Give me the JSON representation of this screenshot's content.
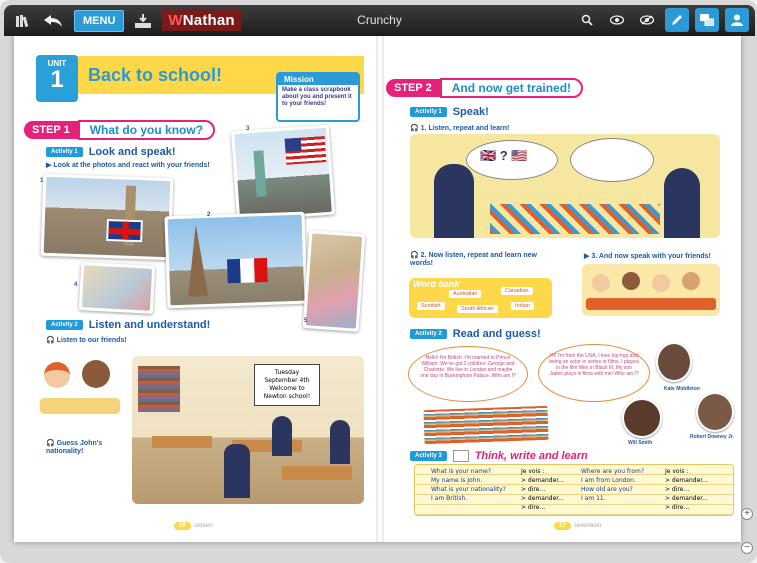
{
  "toolbar": {
    "title": "Crunchy",
    "menu_label": "MENU",
    "brand": "Nathan",
    "brand_prefix": "W",
    "left_icons": [
      "library-icon",
      "back-icon",
      "menu-button",
      "download-icon",
      "nathan-logo"
    ],
    "right_icons": [
      "search-icon",
      "eye-icon",
      "eye-slash-icon",
      "pen-icon",
      "screen-icon",
      "user-icon"
    ],
    "accent_color": "#2a9bd6"
  },
  "left_page": {
    "unit_label": "UNIT",
    "unit_number": "1",
    "unit_title": "Back to school!",
    "mission": {
      "title": "Mission",
      "text": "Make a class scrapbook about you and present it to your friends!"
    },
    "step1": {
      "label": "STEP 1",
      "title": "What do you know?"
    },
    "activity1": {
      "label": "Activity 1",
      "title": "Look and speak!",
      "instruction": "Look at the photos and react with your friends!"
    },
    "photo_numbers": [
      "1",
      "2",
      "3",
      "4",
      "5"
    ],
    "activity2": {
      "label": "Activity 2",
      "title": "Listen and understand!",
      "instruction": "Listen to our friends!"
    },
    "scene_sign": "Tuesday September 4th Welcome to Newton school!",
    "guess": "Guess John's nationality!",
    "page_number": "10",
    "page_word": "sixteen"
  },
  "right_page": {
    "step2": {
      "label": "STEP 2",
      "title": "And now get trained!"
    },
    "activity1": {
      "label": "Activity 1",
      "title": "Speak!",
      "instr1": "1. Listen, repeat and learn!",
      "instr2": "2. Now listen, repeat and learn new words!",
      "instr3": "3. And now speak with your friends!"
    },
    "word_bank": {
      "title": "Word bank",
      "words": [
        "Australian",
        "Canadian",
        "Scottish",
        "South African",
        "Indian"
      ]
    },
    "activity2": {
      "label": "Activity 2",
      "title": "Read and guess!",
      "bubble1": "Hello! I'm British. I'm married to Prince William. We've got 2 children: George and Charlotte. We live in London and maybe one day in Buckingham Palace. Who am I?",
      "bubble2": "Hi! I'm from the USA. I love hip-hop and being an actor in series or films. I played in the film Men in Black III. My son Jaden plays in films with me! Who am I?",
      "celeb1": "Kate Middleton",
      "celeb2": "Will Smith",
      "celeb3": "Robert Downey Jr."
    },
    "activity3": {
      "label": "Activity 3",
      "title": "Think, write and learn"
    },
    "table": {
      "q1": [
        "What is your name?",
        "My name is John.",
        "What is your nationality?",
        "I am British."
      ],
      "h1": "Je vois :",
      "a1": [
        "> demander...",
        "> dire...",
        "> demander...",
        "> dire..."
      ],
      "q2": [
        "Where are you from?",
        "I am from London.",
        "How old are you?",
        "I am 11."
      ],
      "h2": "Je vois :",
      "a2": [
        "> demander...",
        "> dire...",
        "> demander...",
        "> dire..."
      ]
    },
    "page_number": "17",
    "page_word": "seventeen"
  }
}
